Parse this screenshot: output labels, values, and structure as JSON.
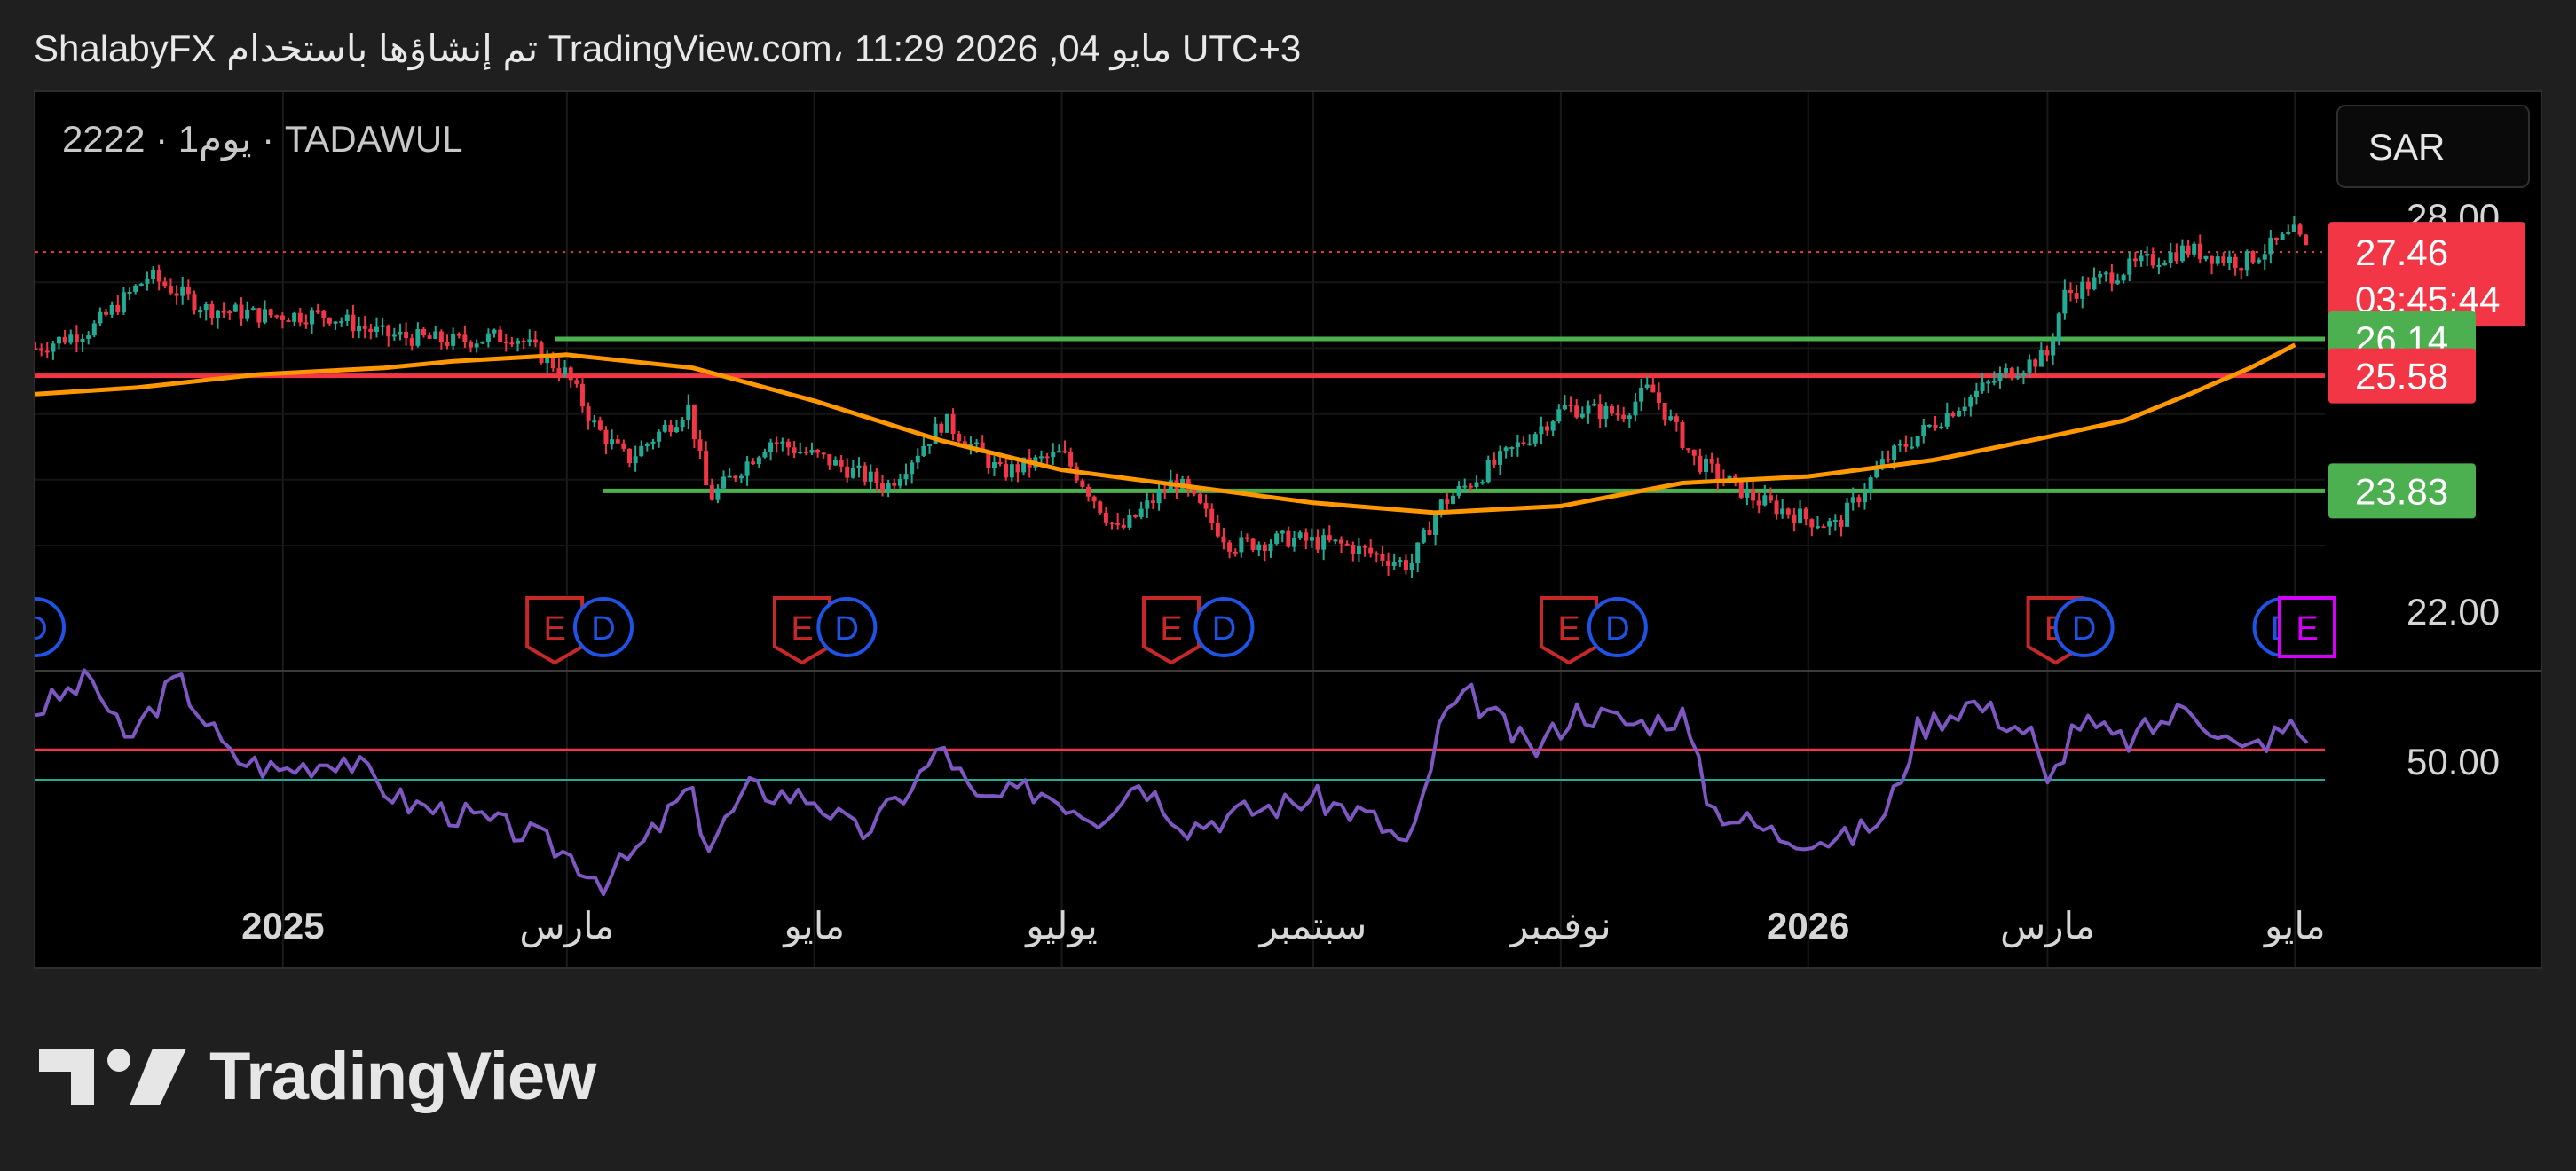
{
  "header": {
    "caption": "ShalabyFX تم إنشاؤها باستخدام TradingView.com، 11:29 2026 ,04 مايو UTC+3"
  },
  "symbol_label": "2222 · 1يوم · TADAWUL",
  "currency": "SAR",
  "brand": "TradingView",
  "colors": {
    "up": "#22ab94",
    "down": "#f23645",
    "ma": "#ff9800",
    "rsi": "#7e57c2",
    "support_line": "#4caf50",
    "resistance_line": "#f23645",
    "earnings_marker": "#c62828",
    "dividend_marker": "#1e53e5",
    "earnings_upcoming_marker": "#d500f9"
  },
  "chart_data": {
    "type": "candlestick",
    "y_ticks": [
      "28.00",
      "22.00"
    ],
    "ylim": [
      21.0,
      28.6
    ],
    "x_ticks": [
      "2025",
      "مارس",
      "مايو",
      "يوليو",
      "سبتمبر",
      "نوفمبر",
      "2026",
      "مارس",
      "مايو"
    ],
    "last_price": "27.46",
    "countdown": "03:45:44",
    "horizontal_lines": [
      {
        "value": "26.14",
        "color": "green",
        "from": "2025-02-26"
      },
      {
        "value": "25.58",
        "color": "red",
        "from": "2024-10-21"
      },
      {
        "value": "23.83",
        "color": "green",
        "from": "2025-03-10"
      }
    ],
    "series": [
      {
        "kind": "price",
        "points": [
          [
            "2024-10-21",
            26.0
          ],
          [
            "2024-11-04",
            26.3
          ],
          [
            "2024-11-18",
            27.1
          ],
          [
            "2024-12-02",
            26.6
          ],
          [
            "2024-12-16",
            26.5
          ],
          [
            "2025-01-01",
            26.5
          ],
          [
            "2025-01-15",
            26.2
          ],
          [
            "2025-02-01",
            26.1
          ],
          [
            "2025-02-16",
            26.2
          ],
          [
            "2025-03-01",
            25.6
          ],
          [
            "2025-03-08",
            24.8
          ],
          [
            "2025-03-16",
            24.3
          ],
          [
            "2025-03-31",
            25.1
          ],
          [
            "2025-04-05",
            23.7
          ],
          [
            "2025-04-20",
            24.6
          ],
          [
            "2025-05-04",
            24.3
          ],
          [
            "2025-05-19",
            23.9
          ],
          [
            "2025-06-02",
            24.9
          ],
          [
            "2025-06-16",
            24.1
          ],
          [
            "2025-07-01",
            24.4
          ],
          [
            "2025-07-15",
            23.2
          ],
          [
            "2025-07-29",
            24.0
          ],
          [
            "2025-08-12",
            23.0
          ],
          [
            "2025-08-26",
            23.1
          ],
          [
            "2025-09-09",
            23.0
          ],
          [
            "2025-09-25",
            22.7
          ],
          [
            "2025-10-02",
            23.6
          ],
          [
            "2025-10-17",
            24.3
          ],
          [
            "2025-11-02",
            25.1
          ],
          [
            "2025-11-16",
            25.0
          ],
          [
            "2025-11-23",
            25.4
          ],
          [
            "2025-12-04",
            24.3
          ],
          [
            "2025-12-19",
            23.7
          ],
          [
            "2026-01-01",
            23.4
          ],
          [
            "2026-01-08",
            23.3
          ],
          [
            "2026-01-20",
            24.3
          ],
          [
            "2026-02-04",
            25.0
          ],
          [
            "2026-02-18",
            25.6
          ],
          [
            "2026-03-01",
            25.9
          ],
          [
            "2026-03-05",
            26.8
          ],
          [
            "2026-03-20",
            27.2
          ],
          [
            "2026-04-04",
            27.5
          ],
          [
            "2026-04-18",
            27.3
          ],
          [
            "2026-05-01",
            27.75
          ],
          [
            "2026-05-04",
            27.46
          ]
        ]
      },
      {
        "kind": "moving_average",
        "points": [
          [
            "2024-10-21",
            25.3
          ],
          [
            "2024-11-15",
            25.4
          ],
          [
            "2024-12-15",
            25.6
          ],
          [
            "2025-01-15",
            25.7
          ],
          [
            "2025-02-01",
            25.8
          ],
          [
            "2025-03-01",
            25.9
          ],
          [
            "2025-04-01",
            25.7
          ],
          [
            "2025-05-01",
            25.2
          ],
          [
            "2025-06-01",
            24.6
          ],
          [
            "2025-07-01",
            24.15
          ],
          [
            "2025-08-01",
            23.9
          ],
          [
            "2025-09-01",
            23.65
          ],
          [
            "2025-10-01",
            23.5
          ],
          [
            "2025-11-01",
            23.6
          ],
          [
            "2025-12-01",
            23.95
          ],
          [
            "2026-01-01",
            24.05
          ],
          [
            "2026-02-01",
            24.3
          ],
          [
            "2026-03-01",
            24.65
          ],
          [
            "2026-03-20",
            24.9
          ],
          [
            "2026-04-05",
            25.3
          ],
          [
            "2026-04-20",
            25.7
          ],
          [
            "2026-05-01",
            26.05
          ]
        ]
      },
      {
        "kind": "rsi",
        "levels": [
          "50.00"
        ],
        "points": [
          [
            "2024-10-21",
            65
          ],
          [
            "2024-11-04",
            72
          ],
          [
            "2024-11-12",
            58
          ],
          [
            "2024-11-25",
            72
          ],
          [
            "2024-12-08",
            55
          ],
          [
            "2024-12-20",
            52
          ],
          [
            "2025-01-05",
            55
          ],
          [
            "2025-01-20",
            45
          ],
          [
            "2025-02-05",
            42
          ],
          [
            "2025-02-20",
            38
          ],
          [
            "2025-03-01",
            34
          ],
          [
            "2025-03-10",
            28
          ],
          [
            "2025-03-20",
            36
          ],
          [
            "2025-03-31",
            48
          ],
          [
            "2025-04-05",
            36
          ],
          [
            "2025-04-15",
            48
          ],
          [
            "2025-05-01",
            46
          ],
          [
            "2025-05-12",
            38
          ],
          [
            "2025-05-20",
            44
          ],
          [
            "2025-06-02",
            57
          ],
          [
            "2025-06-10",
            45
          ],
          [
            "2025-06-25",
            48
          ],
          [
            "2025-07-10",
            42
          ],
          [
            "2025-07-20",
            50
          ],
          [
            "2025-08-01",
            40
          ],
          [
            "2025-08-15",
            43
          ],
          [
            "2025-09-01",
            46
          ],
          [
            "2025-09-15",
            42
          ],
          [
            "2025-09-25",
            35
          ],
          [
            "2025-10-03",
            64
          ],
          [
            "2025-10-10",
            68
          ],
          [
            "2025-10-25",
            56
          ],
          [
            "2025-11-05",
            65
          ],
          [
            "2025-11-20",
            62
          ],
          [
            "2025-12-01",
            64
          ],
          [
            "2025-12-08",
            44
          ],
          [
            "2025-12-25",
            38
          ],
          [
            "2026-01-10",
            37
          ],
          [
            "2026-01-20",
            42
          ],
          [
            "2026-01-28",
            61
          ],
          [
            "2026-02-10",
            67
          ],
          [
            "2026-02-25",
            60
          ],
          [
            "2026-03-01",
            48
          ],
          [
            "2026-03-08",
            63
          ],
          [
            "2026-03-20",
            58
          ],
          [
            "2026-04-05",
            66
          ],
          [
            "2026-04-18",
            56
          ],
          [
            "2026-05-01",
            62
          ],
          [
            "2026-05-04",
            58
          ]
        ]
      }
    ],
    "events": [
      {
        "type": "D",
        "date": "2024-10-21"
      },
      {
        "type": "E",
        "date": "2025-02-26"
      },
      {
        "type": "D",
        "date": "2025-03-10"
      },
      {
        "type": "E",
        "date": "2025-04-28"
      },
      {
        "type": "D",
        "date": "2025-05-09"
      },
      {
        "type": "E",
        "date": "2025-07-28"
      },
      {
        "type": "D",
        "date": "2025-08-10"
      },
      {
        "type": "E",
        "date": "2025-11-03"
      },
      {
        "type": "D",
        "date": "2025-11-15"
      },
      {
        "type": "E",
        "date": "2026-03-03"
      },
      {
        "type": "D",
        "date": "2026-03-10"
      },
      {
        "type": "D",
        "date": "2026-04-28"
      },
      {
        "type": "E",
        "date": "2026-05-04",
        "upcoming": true
      }
    ]
  }
}
